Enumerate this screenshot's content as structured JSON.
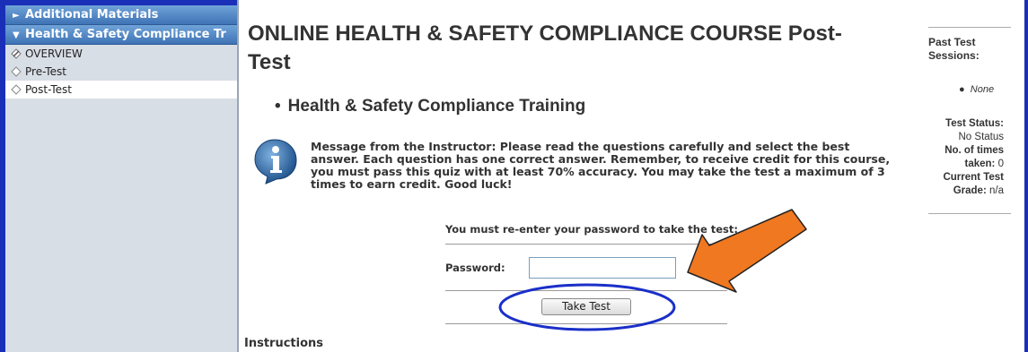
{
  "sidebar": {
    "headers": [
      {
        "label": "Additional Materials",
        "arrow": "►"
      },
      {
        "label": "Health & Safety Compliance Tr",
        "arrow": "▼"
      }
    ],
    "items": [
      {
        "label": "OVERVIEW",
        "icon": "pencil-diamond-icon"
      },
      {
        "label": "Pre-Test",
        "icon": "diamond-icon"
      },
      {
        "label": "Post-Test",
        "icon": "diamond-icon",
        "active": true
      }
    ]
  },
  "main": {
    "title_line1": "ONLINE HEALTH & SAFETY COMPLIANCE COURSE Post-",
    "title_line2": "Test",
    "course_name": "Health & Safety Compliance Training",
    "message_lines": [
      "Message from the Instructor: Please read the questions carefully and select the best",
      "answer. Each question has one correct answer. Remember, to receive credit for this course,",
      "you must pass this quiz with at least 70% accuracy. You may take the test a maximum of 3",
      "times to earn credit. Good luck!"
    ],
    "password_prompt": "You must re-enter your password to take the test:",
    "password_label": "Password:",
    "password_value": "",
    "take_test_label": "Take Test",
    "instructions_heading": "Instructions"
  },
  "right_panel": {
    "past_sessions_line1": "Past Test",
    "past_sessions_line2": "Sessions:",
    "none_label": "None",
    "test_status_label": "Test Status:",
    "status_value": "No Status",
    "times_taken_label_line1": "No. of times",
    "times_taken_label_line2": "taken:",
    "times_taken_value": "0",
    "current_test_line1": "Current Test",
    "grade_label": "Grade:",
    "grade_value": "n/a"
  },
  "colors": {
    "annotation_arrow": "#f07820",
    "annotation_ellipse": "#1a2fc8",
    "sidebar_header": "#3f73b5",
    "frame_blue": "#1a2fb8"
  }
}
